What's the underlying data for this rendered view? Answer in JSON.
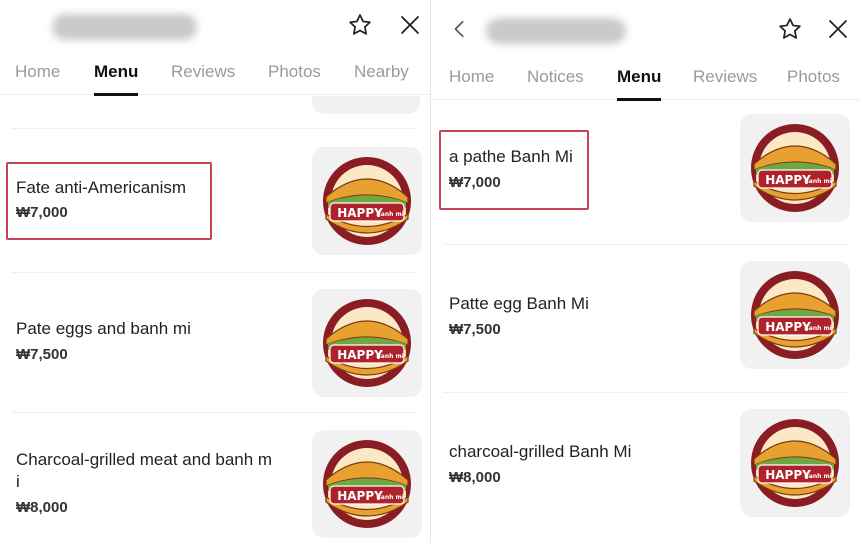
{
  "left": {
    "tabs": [
      {
        "label": "Home",
        "active": false
      },
      {
        "label": "Menu",
        "active": true
      },
      {
        "label": "Reviews",
        "active": false
      },
      {
        "label": "Photos",
        "active": false
      },
      {
        "label": "Nearby",
        "active": false
      }
    ],
    "items": [
      {
        "name": "Fate anti-Americanism",
        "price": "₩7,000",
        "highlighted": true
      },
      {
        "name": "Pate eggs and banh mi",
        "price": "₩7,500",
        "highlighted": false
      },
      {
        "name": "Charcoal-grilled meat and banh m\ni",
        "price": "₩8,000",
        "highlighted": false
      }
    ]
  },
  "right": {
    "tabs": [
      {
        "label": "Home",
        "active": false
      },
      {
        "label": "Notices",
        "active": false
      },
      {
        "label": "Menu",
        "active": true
      },
      {
        "label": "Reviews",
        "active": false
      },
      {
        "label": "Photos",
        "active": false
      }
    ],
    "items": [
      {
        "name": "a pathe Banh Mi",
        "price": "₩7,000",
        "highlighted": true
      },
      {
        "name": "Patte egg Banh Mi",
        "price": "₩7,500",
        "highlighted": false
      },
      {
        "name": "charcoal-grilled Banh Mi",
        "price": "₩8,000",
        "highlighted": false
      }
    ]
  },
  "logo": {
    "brand_text": "HAPPY",
    "sub_text": "Banh mi",
    "colors": {
      "ring": "#8a1d24",
      "bun": "#e8a030",
      "fill": "#f7d99a",
      "badge": "#b0222b"
    }
  },
  "colors": {
    "highlight": "#c4455a",
    "active_tab": "#111111",
    "inactive_tab": "#9a9a9a"
  },
  "icons": {
    "star": "star-icon",
    "close": "close-icon",
    "back": "back-icon"
  }
}
